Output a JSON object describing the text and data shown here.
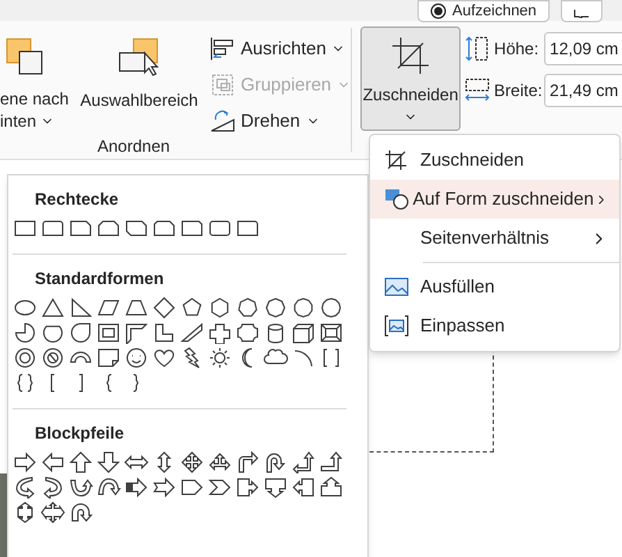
{
  "top_bar": {
    "record_button": "Aufzeichnen"
  },
  "ribbon": {
    "send_backward": {
      "lines": [
        "ene nach",
        "inten"
      ]
    },
    "selection_pane": {
      "label": "Auswahlbereich"
    },
    "small_buttons": [
      {
        "label": "Ausrichten",
        "disabled": false
      },
      {
        "label": "Gruppieren",
        "disabled": true
      },
      {
        "label": "Drehen",
        "disabled": false
      }
    ],
    "group_label": "Anordnen",
    "crop_button": {
      "label": "Zuschneiden",
      "pressed": true
    },
    "size_fields": [
      {
        "label": "Höhe:",
        "value": "12,09 cm"
      },
      {
        "label": "Breite:",
        "value": "21,49 cm"
      }
    ]
  },
  "crop_menu": [
    {
      "label": "Zuschneiden",
      "selected": false,
      "submenu": false,
      "divider_before": false
    },
    {
      "label": "Auf Form zuschneiden",
      "selected": true,
      "submenu": true,
      "divider_before": false
    },
    {
      "label": "Seitenverhältnis",
      "selected": false,
      "submenu": true,
      "divider_before": false
    },
    {
      "label": "Ausfüllen",
      "selected": false,
      "submenu": false,
      "divider_before": true
    },
    {
      "label": "Einpassen",
      "selected": false,
      "submenu": false,
      "divider_before": false
    }
  ],
  "shapes_gallery": {
    "sections": [
      {
        "title": "Rechtecke"
      },
      {
        "title": "Standardformen"
      },
      {
        "title": "Blockpfeile"
      }
    ]
  }
}
